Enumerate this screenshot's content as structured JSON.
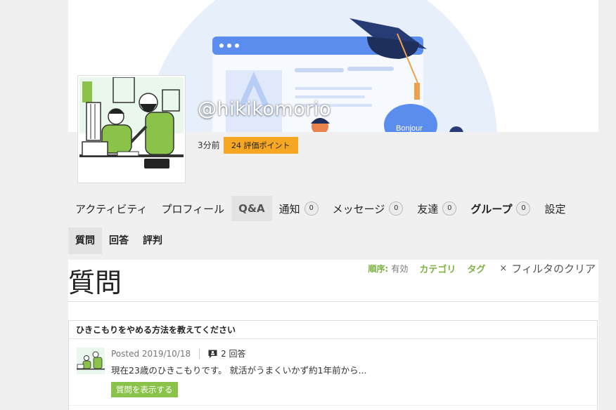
{
  "profile": {
    "username": "@hikikomorio",
    "last_active": "3分前",
    "points_badge": "24 評価ポイント"
  },
  "cover": {
    "caption": "Bonjour"
  },
  "nav": {
    "items": [
      {
        "label": "アクティビティ"
      },
      {
        "label": "プロフィール"
      },
      {
        "label": "Q&A",
        "active": true
      },
      {
        "label": "通知",
        "count": "0"
      },
      {
        "label": "メッセージ",
        "count": "0"
      },
      {
        "label": "友達",
        "count": "0"
      },
      {
        "label": "グループ",
        "count": "0"
      },
      {
        "label": "設定"
      }
    ]
  },
  "subnav": {
    "items": [
      {
        "label": "質問",
        "active": true
      },
      {
        "label": "回答"
      },
      {
        "label": "評判"
      }
    ]
  },
  "content": {
    "title": "質問",
    "filters": {
      "order_label": "順序:",
      "order_value": "有効",
      "category": "カテゴリ",
      "tag": "タグ",
      "clear_icon": "×",
      "clear": "フィルタのクリア"
    }
  },
  "questions": [
    {
      "title": "ひきこもりをやめる方法を教えてください",
      "posted": "Posted 2019/10/18",
      "answers": "2 回答",
      "excerpt": "現在23歳のひきこもりです。 就活がうまくいかず約1年前から...",
      "view_button": "質問を表示する"
    }
  ],
  "colors": {
    "accent_green": "#8bc34a",
    "badge_orange": "#f5a623",
    "cover_blue": "#5b8def",
    "cap_navy": "#273c75"
  }
}
